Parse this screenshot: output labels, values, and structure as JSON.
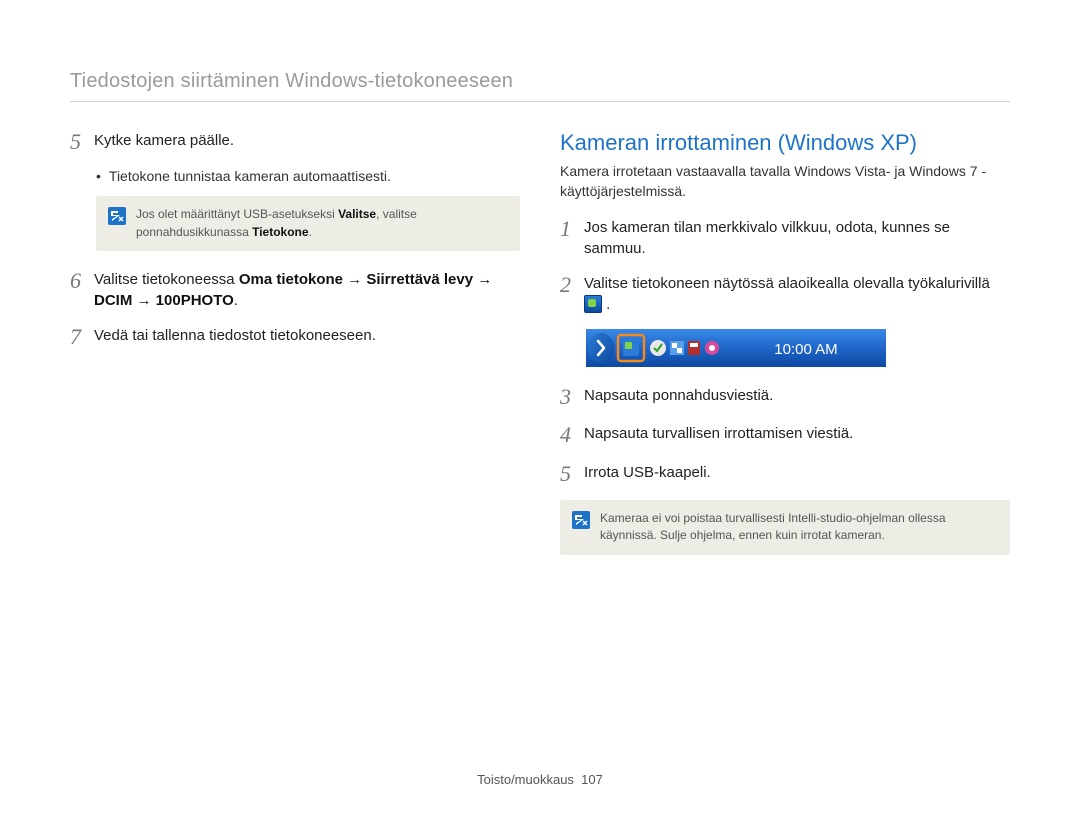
{
  "header": {
    "title": "Tiedostojen siirtäminen Windows-tietokoneeseen"
  },
  "left": {
    "step5": {
      "num": "5",
      "text": "Kytke kamera päälle.",
      "bullet": "Tietokone tunnistaa kameran automaattisesti."
    },
    "note1": {
      "pre": "Jos olet määrittänyt USB-asetukseksi ",
      "bold1": "Valitse",
      "mid": ", valitse ponnahdusikkunassa ",
      "bold2": "Tietokone",
      "post": "."
    },
    "step6": {
      "num": "6",
      "pre": "Valitse tietokoneessa ",
      "b1": "Oma tietokone",
      "arrow1": " → ",
      "b2": "Siirrettävä levy",
      "arrow2": " → ",
      "b3": "DCIM",
      "arrow3": " → ",
      "b4": "100PHOTO",
      "post": "."
    },
    "step7": {
      "num": "7",
      "text": "Vedä tai tallenna tiedostot tietokoneeseen."
    }
  },
  "right": {
    "heading": "Kameran irrottaminen (Windows XP)",
    "sub": "Kamera irrotetaan vastaavalla tavalla Windows Vista- ja Windows 7 -käyttöjärjestelmissä.",
    "step1": {
      "num": "1",
      "text": "Jos kameran tilan merkkivalo vilkkuu, odota, kunnes se sammuu."
    },
    "step2": {
      "num": "2",
      "pre": "Valitse tietokoneen näytössä alaoikealla olevalla työkalurivillä ",
      "post": " ."
    },
    "tray_time": "10:00 AM",
    "step3": {
      "num": "3",
      "text": "Napsauta ponnahdusviestiä."
    },
    "step4": {
      "num": "4",
      "text": "Napsauta turvallisen irrottamisen viestiä."
    },
    "step5": {
      "num": "5",
      "text": "Irrota USB-kaapeli."
    },
    "note2": "Kameraa ei voi poistaa turvallisesti Intelli-studio-ohjelman ollessa käynnissä. Sulje ohjelma, ennen kuin irrotat kameran."
  },
  "footer": {
    "section": "Toisto/muokkaus",
    "page": "107"
  }
}
